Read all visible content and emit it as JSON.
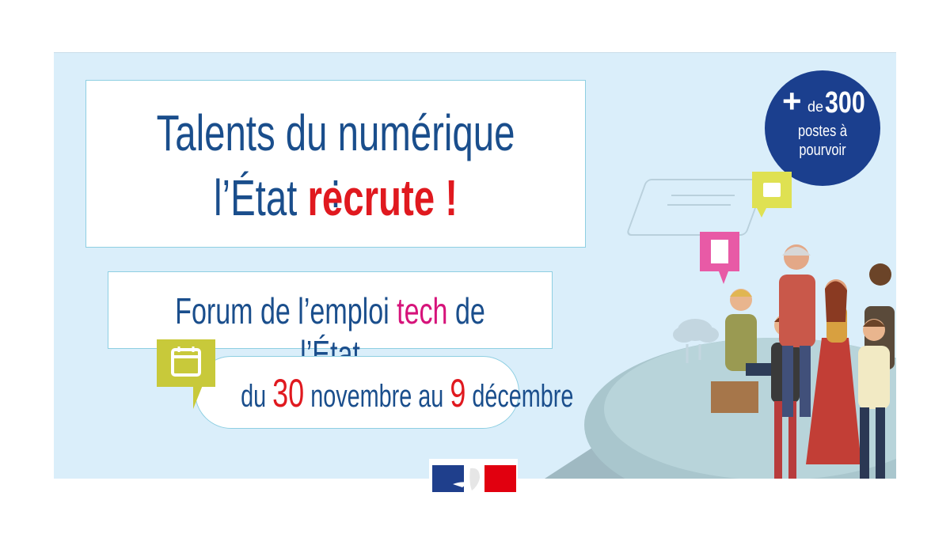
{
  "title": {
    "line1": "Talents du numérique :",
    "line2_prefix": "l’État ",
    "line2_accent": "recrute !"
  },
  "forum": {
    "prefix": "Forum de l’emploi ",
    "accent": "tech",
    "suffix": " de l’État"
  },
  "dates": {
    "prefix": "du ",
    "start_day": "30",
    "middle": " novembre au ",
    "end_day": "9",
    "suffix": " décembre"
  },
  "badge": {
    "plus": "+",
    "de": "de",
    "number": "300",
    "line1": "postes à",
    "line2": "pourvoir"
  },
  "colors": {
    "background": "#daeefa",
    "navy": "#1a4e8c",
    "red": "#e0191f",
    "pink": "#d6137a",
    "badge": "#1b3f8e",
    "olive": "#c8c93a"
  },
  "icons": [
    "calendar-icon",
    "briefcase-icon",
    "resume-icon",
    "cloud-icon",
    "marianne-logo"
  ]
}
